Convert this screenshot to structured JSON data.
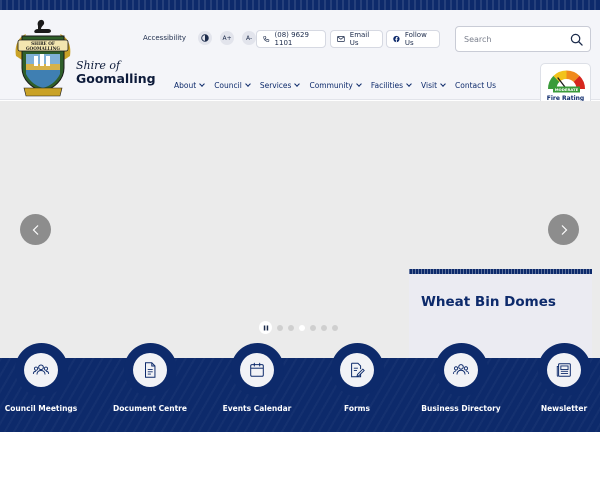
{
  "header": {
    "brand_line1": "Shire of",
    "brand_line2": "Goomalling",
    "logo_banner": "SHIRE OF GOOMALLING",
    "accessibility_label": "Accessibility",
    "contrast_icon": "contrast-icon",
    "font_increase": "A+",
    "font_decrease": "A-",
    "phone": "(08) 9629 1101",
    "email_label": "Email Us",
    "follow_label": "Follow Us",
    "search_placeholder": "Search"
  },
  "nav": {
    "items": [
      {
        "label": "About",
        "has_dropdown": true
      },
      {
        "label": "Council",
        "has_dropdown": true
      },
      {
        "label": "Services",
        "has_dropdown": true
      },
      {
        "label": "Community",
        "has_dropdown": true
      },
      {
        "label": "Facilities",
        "has_dropdown": true
      },
      {
        "label": "Visit",
        "has_dropdown": true
      },
      {
        "label": "Contact Us",
        "has_dropdown": false
      }
    ]
  },
  "fire_rating": {
    "label": "Fire Rating",
    "level": "MODERATE"
  },
  "hero": {
    "slide_title": "Wheat Bin Domes",
    "slide_count": 6,
    "active_slide": 3
  },
  "quick_links": [
    {
      "label": "Council Meetings",
      "icon": "people-group-icon"
    },
    {
      "label": "Document Centre",
      "icon": "document-icon"
    },
    {
      "label": "Events Calendar",
      "icon": "calendar-icon"
    },
    {
      "label": "Forms",
      "icon": "form-edit-icon"
    },
    {
      "label": "Business Directory",
      "icon": "business-people-icon"
    },
    {
      "label": "Newsletter",
      "icon": "newsletter-icon"
    }
  ],
  "colors": {
    "primary_navy": "#0d2a6b",
    "header_bg": "#f4f5f9",
    "hero_bg": "#ebebeb"
  }
}
